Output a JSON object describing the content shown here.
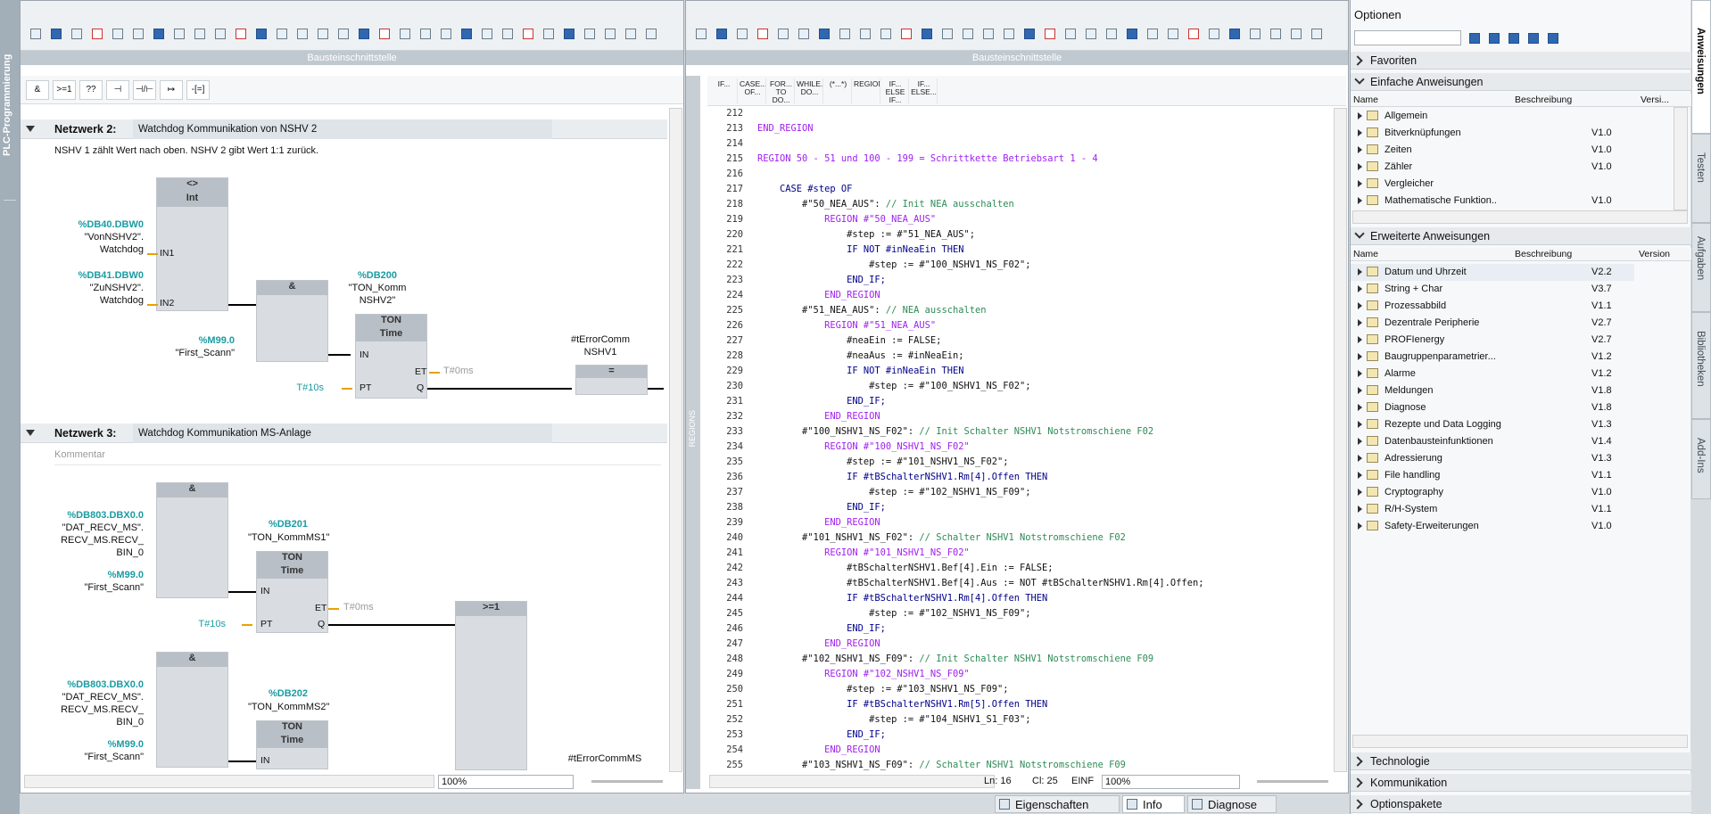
{
  "side_tab": "PLC-Programmierung",
  "lad": {
    "header": "Bausteinschnittstelle",
    "instr_palette": [
      "&",
      ">=1",
      "??",
      "⊣",
      "⊣/⊢",
      "↦",
      "-[=]"
    ],
    "net2": {
      "title": "Netzwerk 2:",
      "desc": "Watchdog Kommunikation von NSHV 2",
      "comment": "NSHV 1 zählt Wert nach oben. NSHV 2 gibt Wert 1:1 zurück.",
      "cmp_op": "<>",
      "cmp_type": "Int",
      "in1_addr": "%DB40.DBW0",
      "in1_name": "\"VonNSHV2\".",
      "in1_name2": "Watchdog",
      "in2_addr": "%DB41.DBW0",
      "in2_name": "\"ZuNSHV2\".",
      "in2_name2": "Watchdog",
      "pin_in1": "IN1",
      "pin_in2": "IN2",
      "and_op": "&",
      "m_addr": "%M99.0",
      "m_name": "\"First_Scann\"",
      "db_addr": "%DB200",
      "db_name": "\"TON_Komm",
      "db_name2": "NSHV2\"",
      "ton": "TON",
      "time": "Time",
      "pin_in": "IN",
      "pin_pt": "PT",
      "pin_et": "ET",
      "pin_q": "Q",
      "pt": "T#10s",
      "et": "T#0ms",
      "out_name": "#tErrorComm",
      "out_name2": "NSHV1",
      "coil": "="
    },
    "net3": {
      "title": "Netzwerk 3:",
      "desc": "Watchdog Kommunikation MS-Anlage",
      "comment": "Kommentar",
      "and_op": "&",
      "a1_addr": "%DB803.DBX0.0",
      "a1_l1": "\"DAT_RECV_MS\".",
      "a1_l2": "RECV_MS.RECV_",
      "a1_l3": "BIN_0",
      "m_addr": "%M99.0",
      "m_name": "\"First_Scann\"",
      "db1_addr": "%DB201",
      "db1_name": "\"TON_KommMS1\"",
      "ton": "TON",
      "time": "Time",
      "pin_in": "IN",
      "pin_pt": "PT",
      "pin_et": "ET",
      "pin_q": "Q",
      "pt": "T#10s",
      "et": "T#0ms",
      "or_op": ">=1",
      "db2_addr": "%DB202",
      "db2_name": "\"TON_KommMS2\"",
      "out_name": "#tErrorCommMS"
    },
    "zoom": "100%"
  },
  "scl": {
    "header": "Bausteinschnittstelle",
    "side_label": "REGIONS",
    "snippets": [
      "IF...",
      "CASE... OF...",
      "FOR... TO DO...",
      "WHILE... DO...",
      "(*...*)",
      "REGION",
      "IF... ELSE IF...",
      "IF... ELSE..."
    ],
    "lines": [
      {
        "n": "212",
        "t": ""
      },
      {
        "n": "213",
        "t": "END_REGION",
        "c": "rg"
      },
      {
        "n": "214",
        "t": ""
      },
      {
        "n": "215",
        "t": "REGION 50 - 51 und 100 - 199 = Schrittkette Betriebsart 1 - 4",
        "c": "rg"
      },
      {
        "n": "216",
        "t": ""
      },
      {
        "n": "217",
        "t": "    CASE #step OF",
        "c": "kw"
      },
      {
        "n": "218",
        "t": "        #\"50_NEA_AUS\": ",
        "x": "// Init NEA ausschalten"
      },
      {
        "n": "219",
        "t": "            REGION #\"50_NEA_AUS\"",
        "c": "rg"
      },
      {
        "n": "220",
        "t": "                #step := #\"51_NEA_AUS\";"
      },
      {
        "n": "221",
        "t": "                IF NOT #inNeaEin THEN",
        "c": "kw"
      },
      {
        "n": "222",
        "t": "                    #step := #\"100_NSHV1_NS_F02\";"
      },
      {
        "n": "223",
        "t": "                END_IF;",
        "c": "kw"
      },
      {
        "n": "224",
        "t": "            END_REGION",
        "c": "rg"
      },
      {
        "n": "225",
        "t": "        #\"51_NEA_AUS\": ",
        "x": "// NEA ausschalten"
      },
      {
        "n": "226",
        "t": "            REGION #\"51_NEA_AUS\"",
        "c": "rg"
      },
      {
        "n": "227",
        "t": "                #neaEin := FALSE;"
      },
      {
        "n": "228",
        "t": "                #neaAus := #inNeaEin;"
      },
      {
        "n": "229",
        "t": "                IF NOT #inNeaEin THEN",
        "c": "kw"
      },
      {
        "n": "230",
        "t": "                    #step := #\"100_NSHV1_NS_F02\";"
      },
      {
        "n": "231",
        "t": "                END_IF;",
        "c": "kw"
      },
      {
        "n": "232",
        "t": "            END_REGION",
        "c": "rg"
      },
      {
        "n": "233",
        "t": "        #\"100_NSHV1_NS_F02\": ",
        "x": "// Init Schalter NSHV1 Notstromschiene F02"
      },
      {
        "n": "234",
        "t": "            REGION #\"100_NSHV1_NS_F02\"",
        "c": "rg"
      },
      {
        "n": "235",
        "t": "                #step := #\"101_NSHV1_NS_F02\";"
      },
      {
        "n": "236",
        "t": "                IF #tBSchalterNSHV1.Rm[4].Offen THEN",
        "c": "kw"
      },
      {
        "n": "237",
        "t": "                    #step := #\"102_NSHV1_NS_F09\";"
      },
      {
        "n": "238",
        "t": "                END_IF;",
        "c": "kw"
      },
      {
        "n": "239",
        "t": "            END_REGION",
        "c": "rg"
      },
      {
        "n": "240",
        "t": "        #\"101_NSHV1_NS_F02\": ",
        "x": "// Schalter NSHV1 Notstromschiene F02"
      },
      {
        "n": "241",
        "t": "            REGION #\"101_NSHV1_NS_F02\"",
        "c": "rg"
      },
      {
        "n": "242",
        "t": "                #tBSchalterNSHV1.Bef[4].Ein := FALSE;"
      },
      {
        "n": "243",
        "t": "                #tBSchalterNSHV1.Bef[4].Aus := NOT #tBSchalterNSHV1.Rm[4].Offen;"
      },
      {
        "n": "244",
        "t": "                IF #tBSchalterNSHV1.Rm[4].Offen THEN",
        "c": "kw"
      },
      {
        "n": "245",
        "t": "                    #step := #\"102_NSHV1_NS_F09\";"
      },
      {
        "n": "246",
        "t": "                END_IF;",
        "c": "kw"
      },
      {
        "n": "247",
        "t": "            END_REGION",
        "c": "rg"
      },
      {
        "n": "248",
        "t": "        #\"102_NSHV1_NS_F09\": ",
        "x": "// Init Schalter NSHV1 Notstromschiene F09"
      },
      {
        "n": "249",
        "t": "            REGION #\"102_NSHV1_NS_F09\"",
        "c": "rg"
      },
      {
        "n": "250",
        "t": "                #step := #\"103_NSHV1_NS_F09\";"
      },
      {
        "n": "251",
        "t": "                IF #tBSchalterNSHV1.Rm[5].Offen THEN",
        "c": "kw"
      },
      {
        "n": "252",
        "t": "                    #step := #\"104_NSHV1_S1_F03\";"
      },
      {
        "n": "253",
        "t": "                END_IF;",
        "c": "kw"
      },
      {
        "n": "254",
        "t": "            END_REGION",
        "c": "rg"
      },
      {
        "n": "255",
        "t": "        #\"103_NSHV1_NS_F09\": ",
        "x": "// Schalter NSHV1 Notstromschiene F09"
      }
    ],
    "status_ln": "Ln: 16",
    "status_cl": "Cl: 25",
    "status_mode": "EINF",
    "zoom": "100%"
  },
  "right": {
    "title": "Optionen",
    "favorites": "Favoriten",
    "simple": "Einfache Anweisungen",
    "cols": [
      "Name",
      "Beschreibung",
      "Versi..."
    ],
    "simple_items": [
      {
        "name": "Allgemein",
        "ver": ""
      },
      {
        "name": "Bitverknüpfungen",
        "ver": "V1.0"
      },
      {
        "name": "Zeiten",
        "ver": "V1.0"
      },
      {
        "name": "Zähler",
        "ver": "V1.0"
      },
      {
        "name": "Vergleicher",
        "ver": ""
      },
      {
        "name": "Mathematische Funktion..",
        "ver": "V1.0"
      }
    ],
    "extended": "Erweiterte Anweisungen",
    "cols2": [
      "Name",
      "Beschreibung",
      "Version"
    ],
    "ext_items": [
      {
        "name": "Datum und Uhrzeit",
        "ver": "V2.2"
      },
      {
        "name": "String + Char",
        "ver": "V3.7"
      },
      {
        "name": "Prozessabbild",
        "ver": "V1.1"
      },
      {
        "name": "Dezentrale Peripherie",
        "ver": "V2.7"
      },
      {
        "name": "PROFIenergy",
        "ver": "V2.7"
      },
      {
        "name": "Baugruppenparametrier...",
        "ver": "V1.2"
      },
      {
        "name": "Alarme",
        "ver": "V1.2"
      },
      {
        "name": "Meldungen",
        "ver": "V1.8"
      },
      {
        "name": "Diagnose",
        "ver": "V1.8"
      },
      {
        "name": "Rezepte und Data Logging",
        "ver": "V1.3"
      },
      {
        "name": "Datenbausteinfunktionen",
        "ver": "V1.4"
      },
      {
        "name": "Adressierung",
        "ver": "V1.3"
      },
      {
        "name": "File handling",
        "ver": "V1.1"
      },
      {
        "name": "Cryptography",
        "ver": "V1.0"
      },
      {
        "name": "R/H-System",
        "ver": "V1.1"
      },
      {
        "name": "Safety-Erweiterungen",
        "ver": "V1.0"
      }
    ],
    "technologie": "Technologie",
    "kommunikation": "Kommunikation",
    "optionspakete": "Optionspakete",
    "vtabs": [
      "Anweisungen",
      "Testen",
      "Aufgaben",
      "Bibliotheken",
      "Add-Ins"
    ]
  },
  "bottom_tabs": [
    "Eigenschaften",
    "Info",
    "Diagnose"
  ]
}
